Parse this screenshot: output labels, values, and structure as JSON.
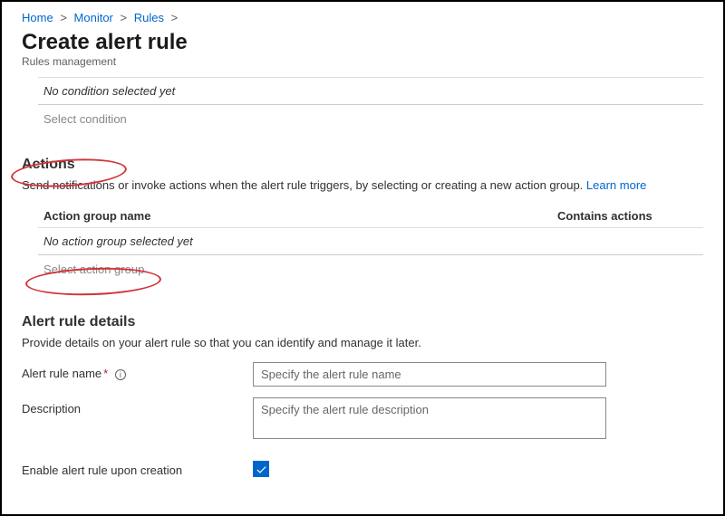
{
  "breadcrumb": {
    "items": [
      "Home",
      "Monitor",
      "Rules"
    ]
  },
  "page": {
    "title": "Create alert rule",
    "subtitle": "Rules management"
  },
  "condition": {
    "empty_text": "No condition selected yet",
    "select_label": "Select condition"
  },
  "actions_section": {
    "heading": "Actions",
    "description": "Send notifications or invoke actions when the alert rule triggers, by selecting or creating a new action group. ",
    "learn_more": "Learn more",
    "col_group_name": "Action group name",
    "col_contains_actions": "Contains actions",
    "empty_text": "No action group selected yet",
    "select_label": "Select action group"
  },
  "details_section": {
    "heading": "Alert rule details",
    "description": "Provide details on your alert rule so that you can identify and manage it later.",
    "name_label": "Alert rule name",
    "name_placeholder": "Specify the alert rule name",
    "desc_label": "Description",
    "desc_placeholder": "Specify the alert rule description",
    "enable_label": "Enable alert rule upon creation"
  }
}
